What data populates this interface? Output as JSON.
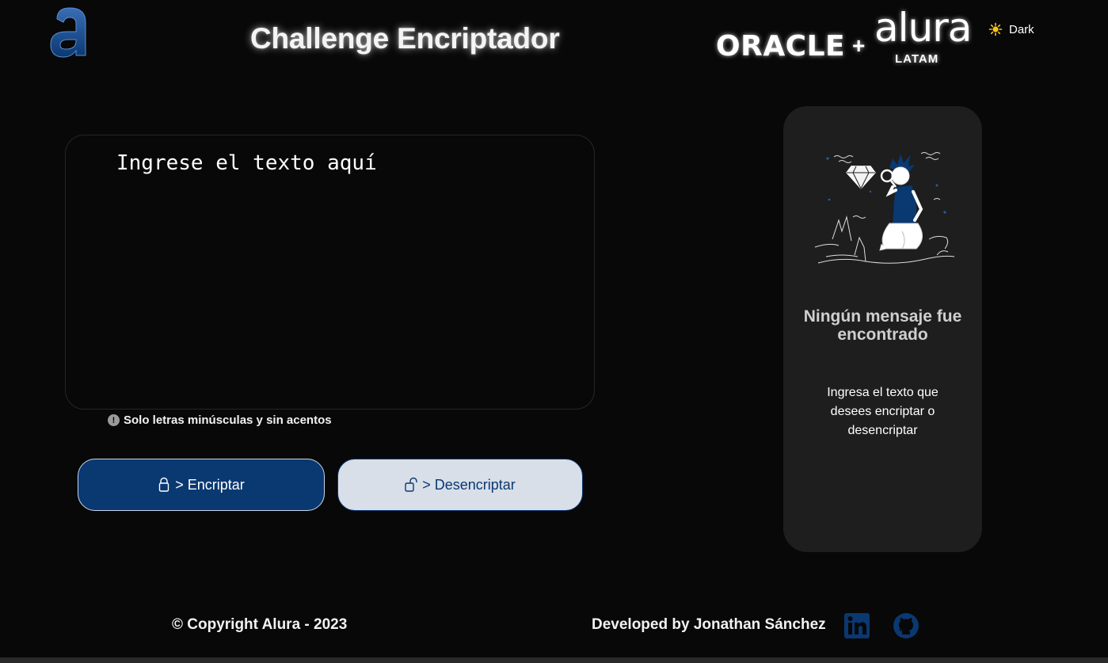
{
  "header": {
    "title": "Challenge Encriptador",
    "partner_oracle": "ORACLE",
    "partner_plus": "+",
    "partner_alura": "alura",
    "partner_latam": "LATAM",
    "theme_toggle_label": "Dark",
    "theme_icon": "sun-icon",
    "logo_icon": "alura-a-logo"
  },
  "input": {
    "placeholder": "Ingrese el texto aquí",
    "value": "",
    "hint_icon": "info-icon",
    "hint": "Solo letras minúsculas y sin acentos"
  },
  "buttons": {
    "encrypt_label": "> Encriptar",
    "encrypt_icon": "lock-icon",
    "decrypt_label": "> Desencriptar",
    "decrypt_icon": "unlock-icon"
  },
  "output": {
    "illustration": "person-with-magnifying-glass-illustration",
    "title": "Ningún mensaje fue encontrado",
    "text": "Ingresa el texto que desees encriptar o desencriptar"
  },
  "footer": {
    "copyright": "© Copyright Alura - 2023",
    "developer": "Developed by Jonathan Sánchez",
    "linkedin_icon": "linkedin-icon",
    "github_icon": "github-icon"
  },
  "colors": {
    "background": "#080808",
    "primary": "#0a3871",
    "secondary": "#d8dfe8",
    "panel": "#1e1e1e",
    "sun": "#f5c518"
  }
}
